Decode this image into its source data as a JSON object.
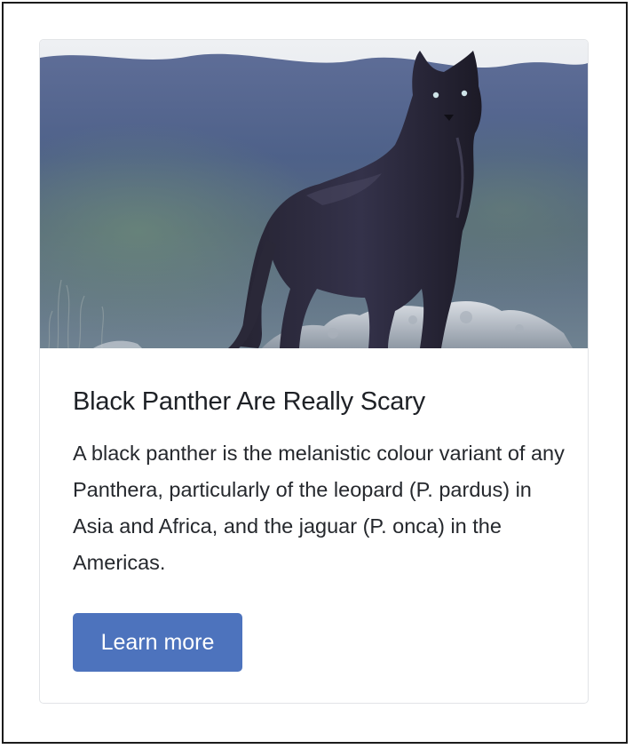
{
  "card": {
    "image_alt": "black-panther-photo",
    "title": "Black Panther Are Really Scary",
    "text": "A black panther is the melanistic colour variant of any Panthera, particularly of the leopard (P. pardus) in Asia and Africa, and the jaguar (P. onca) in the Americas.",
    "button_label": "Learn more"
  },
  "colors": {
    "button_bg": "#4d73bd",
    "button_text": "#ffffff",
    "title_text": "#1e2126",
    "body_text": "#25282d"
  }
}
